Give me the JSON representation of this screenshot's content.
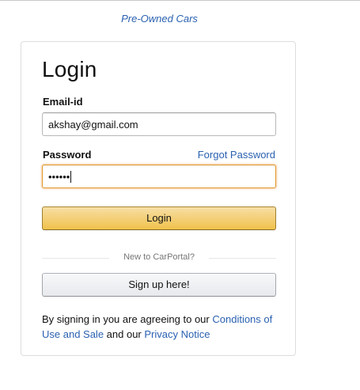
{
  "header": {
    "brand_link": "Pre-Owned Cars"
  },
  "login_form": {
    "title": "Login",
    "email_label": "Email-id",
    "email_value": "akshay@gmail.com",
    "password_label": "Password",
    "password_masked": "••••••",
    "forgot_link": "Forgot Password",
    "login_button": "Login",
    "divider_text": "New to CarPortal?",
    "signup_button": "Sign up here!",
    "legal_prefix": "By signing in you are agreeing to our ",
    "legal_conditions_link": "Conditions of Use and Sale",
    "legal_middle": " and our ",
    "legal_privacy_link": "Privacy Notice"
  },
  "colors": {
    "link": "#2a61b0",
    "primary_button": "#f0c14b",
    "focus_border": "#e59a2f"
  }
}
